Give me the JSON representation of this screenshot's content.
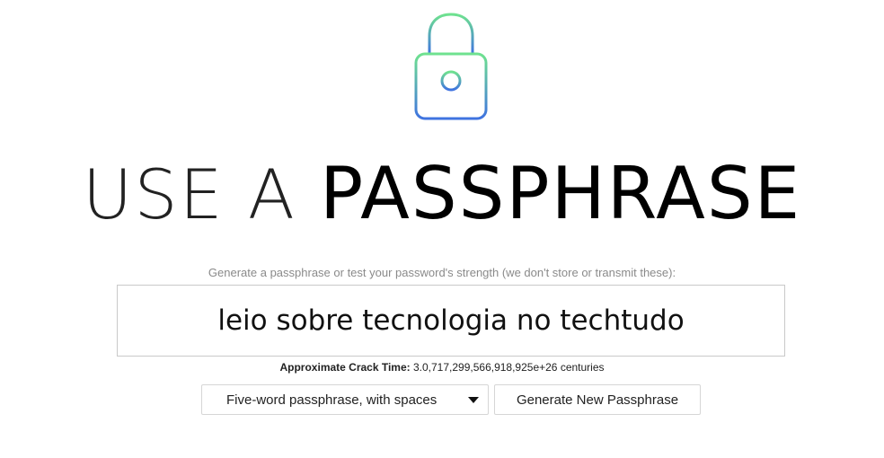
{
  "header": {
    "icon": "lock-icon",
    "title_light": "USE A ",
    "title_bold": "PASSPHRASE",
    "gradient_top": "#6fe28f",
    "gradient_bottom": "#3f73e0"
  },
  "main": {
    "prompt": "Generate a passphrase or test your password's strength (we don't store or transmit these):",
    "passphrase_value": "leio sobre tecnologia no techtudo",
    "crack_label": "Approximate Crack Time:",
    "crack_value": " 3.0,717,299,566,918,925e+26 centuries"
  },
  "controls": {
    "select_value": "Five-word passphrase, with spaces",
    "generate_label": "Generate New Passphrase"
  }
}
